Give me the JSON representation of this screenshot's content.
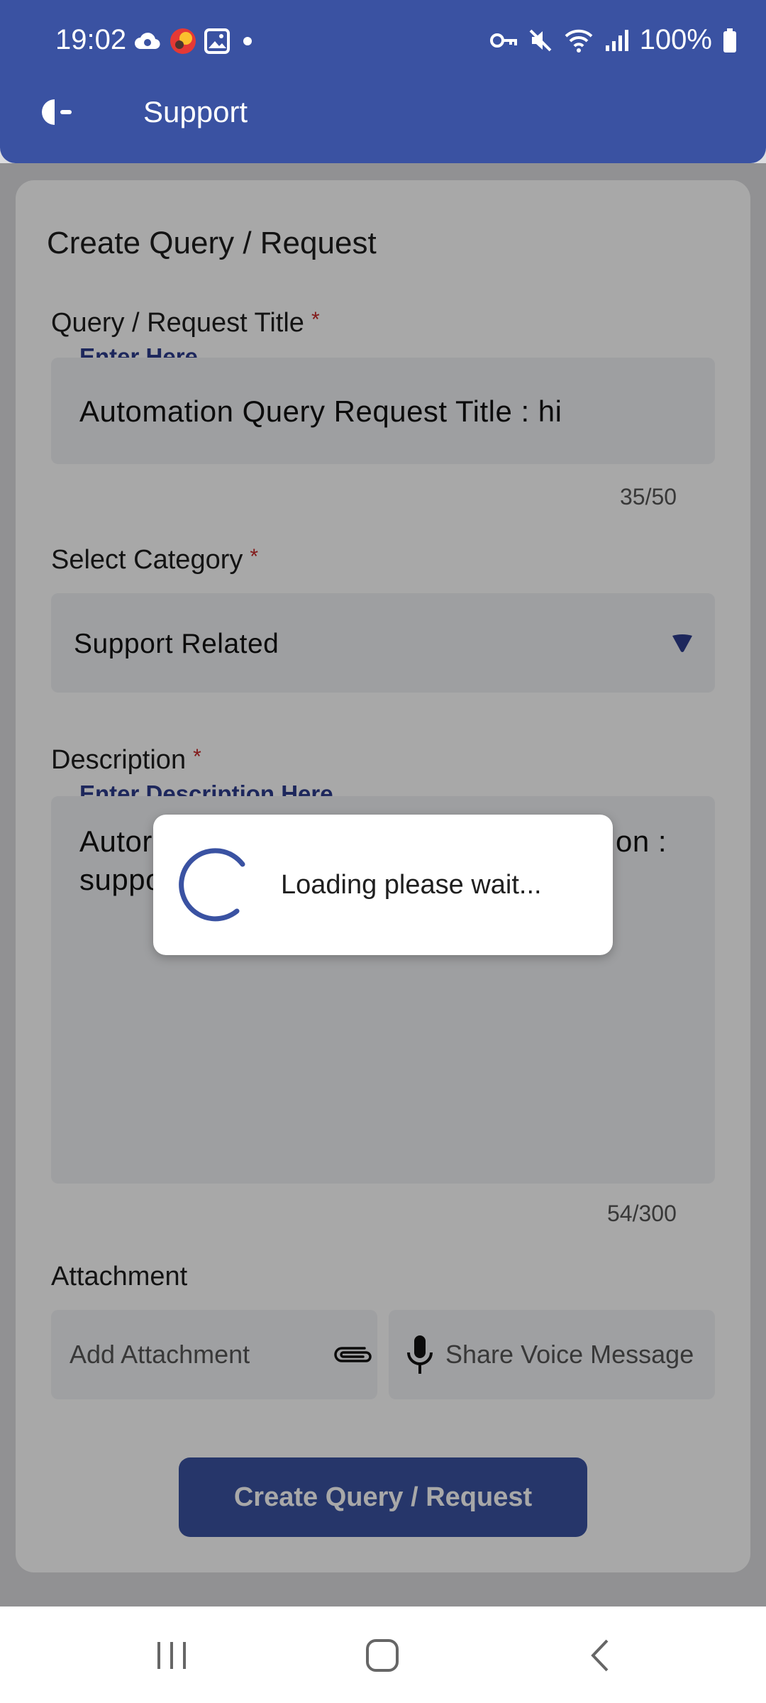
{
  "status_bar": {
    "time": "19:02",
    "battery": "100%"
  },
  "app_bar": {
    "title": "Support"
  },
  "form": {
    "section_title": "Create Query / Request",
    "title_field": {
      "label": "Query / Request Title",
      "required_mark": "*",
      "floating_label": "Enter Here",
      "value": "Automation Query Request Title : hi",
      "counter": "35/50"
    },
    "category_field": {
      "label": "Select Category",
      "required_mark": "*",
      "selected": "Support Related"
    },
    "description_field": {
      "label": "Description",
      "required_mark": "*",
      "floating_label": "Enter Description Here",
      "line1_left": "Autor",
      "line1_right": "on :",
      "line2_left": "suppo",
      "counter": "54/300"
    },
    "attachment": {
      "label": "Attachment",
      "add_label": "Add Attachment",
      "voice_label": "Share Voice Message"
    },
    "submit_label": "Create Query / Request"
  },
  "loading_dialog": {
    "message": "Loading please wait..."
  },
  "colors": {
    "primary": "#3a52a2",
    "required": "#c62828",
    "floating_label": "#2c3c8c"
  }
}
